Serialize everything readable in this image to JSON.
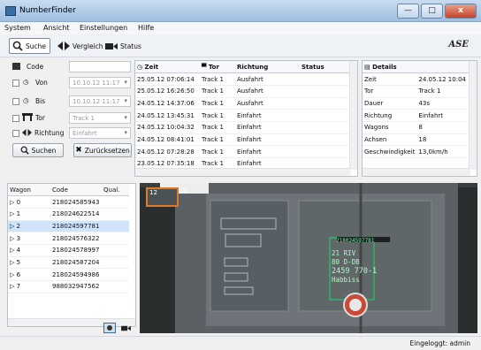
{
  "window": {
    "title": "NumberFinder",
    "min": "—",
    "max": "□",
    "close": "x"
  },
  "menu": [
    "System",
    "Ansicht",
    "Einstellungen",
    "Hilfe"
  ],
  "toolbar": {
    "suche": "Suche",
    "vergleich": "Vergleich",
    "status": "Status",
    "logo": "ASE"
  },
  "filters": {
    "code_label": "Code",
    "code_value": "",
    "von_label": "Von",
    "von_value": "10.10.12 11:17",
    "bis_label": "Bis",
    "bis_value": "10.10.12 11:17",
    "tor_label": "Tor",
    "tor_value": "Track 1",
    "richtung_label": "Richtung",
    "richtung_value": "Einfahrt",
    "suchen": "Suchen",
    "zuruecksetzen": "Zurücksetzen"
  },
  "results": {
    "headers": [
      "Zeit",
      "Tor",
      "Richtung",
      "Status"
    ],
    "rows": [
      [
        "25.05.12 07:06:14",
        "Track 1",
        "Ausfahrt",
        ""
      ],
      [
        "25.05.12 16:26:50",
        "Track 1",
        "Ausfahrt",
        ""
      ],
      [
        "24.05.12 14:37:06",
        "Track 1",
        "Ausfahrt",
        ""
      ],
      [
        "24.05.12 13:45:31",
        "Track 1",
        "Einfahrt",
        ""
      ],
      [
        "24.05.12 10:04:32",
        "Track 1",
        "Einfahrt",
        ""
      ],
      [
        "24.05.12 08:41:01",
        "Track 1",
        "Einfahrt",
        ""
      ],
      [
        "24.05.12 07:28:28",
        "Track 1",
        "Einfahrt",
        ""
      ],
      [
        "23.05.12 07:35:18",
        "Track 1",
        "Einfahrt",
        ""
      ]
    ]
  },
  "details": {
    "title": "Details",
    "rows": [
      [
        "Zeit",
        "24.05.12 10:04"
      ],
      [
        "Tor",
        "Track 1"
      ],
      [
        "Dauer",
        "43s"
      ],
      [
        "Richtung",
        "Einfahrt"
      ],
      [
        "Wagons",
        "8"
      ],
      [
        "Achsen",
        "18"
      ],
      [
        "Geschwindigkeit",
        "13,0km/h"
      ]
    ]
  },
  "wagons": {
    "headers": [
      "Wagon",
      "Code",
      "Qual."
    ],
    "rows": [
      [
        "0",
        "218024585943",
        ""
      ],
      [
        "1",
        "218024622514",
        ""
      ],
      [
        "2",
        "218024597781",
        ""
      ],
      [
        "3",
        "218024576322",
        ""
      ],
      [
        "4",
        "218024578997",
        ""
      ],
      [
        "5",
        "218024587204",
        ""
      ],
      [
        "6",
        "218024594986",
        ""
      ],
      [
        "7",
        "988032947562",
        ""
      ]
    ]
  },
  "image": {
    "thumb_left": "12",
    "thumb_right": "12",
    "plate_lines": [
      "21 RIV",
      "80 D-DB",
      "2459 770-1",
      "Habbiss"
    ],
    "top_code": "218024597781"
  },
  "status": {
    "login": "Eingeloggt: admin"
  }
}
